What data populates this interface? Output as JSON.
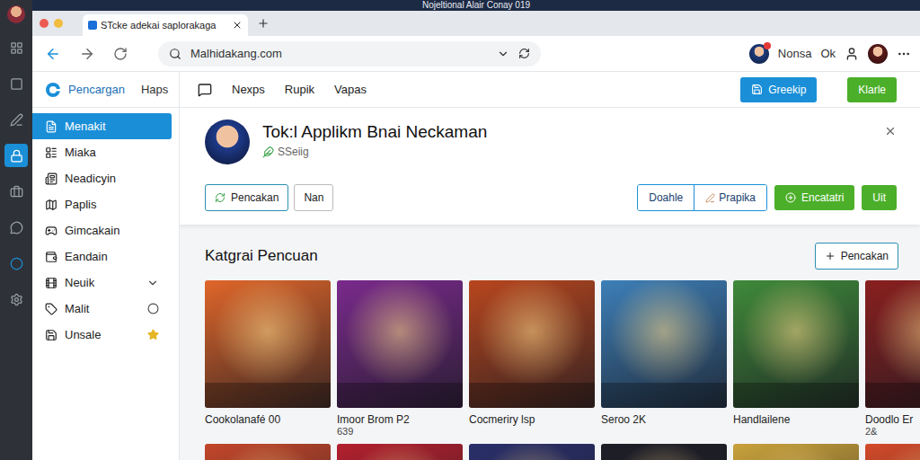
{
  "window": {
    "title": "Nojeltional Alair Conay 019"
  },
  "browser": {
    "tabs": [
      {
        "label": "STcke adekai saplorakaga",
        "selected": true
      }
    ],
    "address": "Malhidakang.com",
    "profile": "Nonsa",
    "ok": "Ok"
  },
  "app": {
    "brand": "Pencargan",
    "brand_link": "Haps",
    "nav": [
      {
        "label": "Nexps"
      },
      {
        "label": "Rupik"
      },
      {
        "label": "Vapas"
      }
    ],
    "buttons": [
      {
        "label": "Greekip",
        "kind": "blue"
      },
      {
        "label": "Klarle",
        "kind": "green"
      }
    ]
  },
  "sidebar": {
    "items": [
      {
        "label": "Menakit",
        "selected": true,
        "kind": "plain"
      },
      {
        "label": "Miaka",
        "selected": false,
        "kind": "plain"
      },
      {
        "label": "Neadicyin",
        "selected": false,
        "kind": "plain"
      },
      {
        "label": "Paplis",
        "selected": false,
        "kind": "plain"
      },
      {
        "label": "Gimcakain",
        "selected": false,
        "kind": "plain"
      },
      {
        "label": "Eandain",
        "selected": false,
        "kind": "plain"
      },
      {
        "label": "Neuik",
        "selected": false,
        "kind": "chevron"
      },
      {
        "label": "Malit",
        "selected": false,
        "kind": "circle"
      },
      {
        "label": "Unsale",
        "selected": false,
        "kind": "star"
      }
    ]
  },
  "profile": {
    "title": "Tok:l Applikm Bnai Neckaman",
    "subtitle": "SSeiig",
    "left_actions": [
      {
        "label": "Pencakan",
        "kind": "accent"
      },
      {
        "label": "Nan",
        "kind": "plain"
      }
    ],
    "right_actions": [
      {
        "label": "Doahle",
        "kind": "segment"
      },
      {
        "label": "Prapika",
        "kind": "segment"
      },
      {
        "label": "Encatatri",
        "kind": "green"
      },
      {
        "label": "Uit",
        "kind": "green"
      }
    ]
  },
  "section": {
    "title": "Katgrai Pencuan",
    "action": "Pencakan"
  },
  "cards": [
    {
      "caption": "Cookolanafé 00",
      "sub": "",
      "color": "#e0662a"
    },
    {
      "caption": "Imoor Brom P2",
      "sub": "639",
      "color": "#7a2a8c"
    },
    {
      "caption": "Cocmeriry lsp",
      "sub": "",
      "color": "#b8461e"
    },
    {
      "caption": "Seroo 2K",
      "sub": "",
      "color": "#3d7fb8"
    },
    {
      "caption": "Handlailene",
      "sub": "",
      "color": "#3f8a3a"
    },
    {
      "caption": "Doodlo Er",
      "sub": "2&",
      "color": "#8a1f1f"
    }
  ],
  "more_cards": [
    {
      "color": "#c2462a"
    },
    {
      "color": "#b3202e"
    },
    {
      "color": "#2a2f6a"
    },
    {
      "color": "#1e1e28"
    },
    {
      "color": "#c9a23a"
    },
    {
      "color": "#d34a2a"
    }
  ]
}
